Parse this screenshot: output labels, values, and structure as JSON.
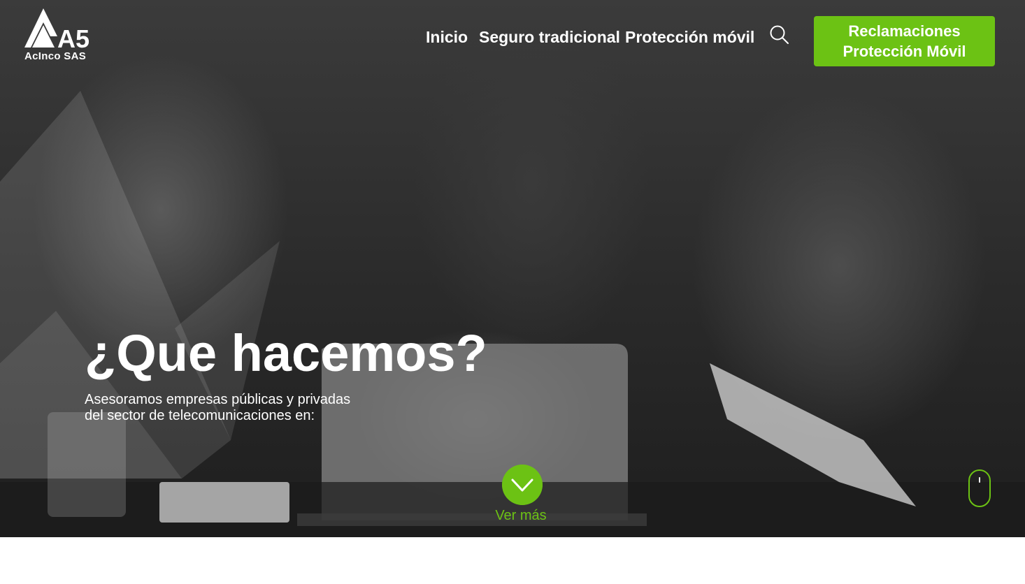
{
  "logo": {
    "mark": "A5",
    "company_name": "AcInco SAS"
  },
  "nav": {
    "items": [
      {
        "label": "Inicio"
      },
      {
        "label": "Seguro tradicional"
      },
      {
        "label": "Protección móvil"
      }
    ],
    "search_icon": "search-icon"
  },
  "cta": {
    "line1": "Reclamaciones",
    "line2": "Protección Móvil"
  },
  "hero": {
    "title": "¿Que hacemos?",
    "subtitle_line1": "Asesoramos empresas públicas y privadas",
    "subtitle_line2": "del sector de telecomunicaciones en:",
    "more_label": "Ver más",
    "more_icon": "chevron-down-icon",
    "scroll_icon": "mouse-scroll-icon"
  },
  "colors": {
    "accent": "#6cc214",
    "text_light": "#ffffff",
    "overlay": "#2b2b2b"
  }
}
